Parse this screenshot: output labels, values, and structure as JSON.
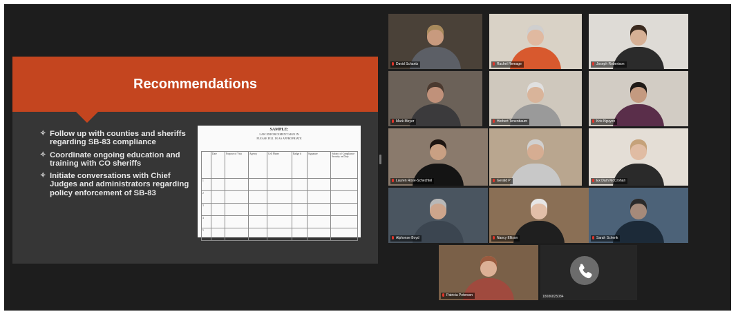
{
  "slide": {
    "title": "Recommendations",
    "bullets": [
      "Follow up with counties and sheriffs regarding SB-83 compliance",
      "Coordinate ongoing education and training with CO sheriffs",
      "Initiate conversations with Chief Judges and administrators regarding policy enforcement of SB-83"
    ],
    "bullet_glyph": "✧",
    "sample_doc": {
      "title": "SAMPLE:",
      "subtitle_1": "LAW ENFORCEMENT SIGN IN",
      "subtitle_2": "PLEASE FILL IN AS APPROPRIATE",
      "columns": [
        "",
        "Date",
        "Purpose of Visit",
        "Agency",
        "Cell Phone",
        "Badge #",
        "Signature",
        "Subject of Compliance Security on Duty"
      ],
      "row_numbers": [
        "1",
        "2",
        "3",
        "4",
        "5"
      ]
    }
  },
  "participants": [
    {
      "name": "David Schantz",
      "bg": "#4a4138",
      "shirt": "#5c5f66",
      "skin": "#c89a7e",
      "hair": "#a88a5c"
    },
    {
      "name": "Rachel Remage",
      "bg": "#d9d2c6",
      "shirt": "#d8592e",
      "skin": "#e0b9a0",
      "hair": "#cfcfcf"
    },
    {
      "name": "Joseph Robertson",
      "bg": "#dedbd6",
      "shirt": "#2b2b2b",
      "skin": "#d6b095",
      "hair": "#3a2a1f"
    },
    {
      "name": "Mark Meyer",
      "bg": "#6b6158",
      "shirt": "#3b3a3c",
      "skin": "#c0917a",
      "hair": "#4a3a30"
    },
    {
      "name": "Herbert Tenenbaum",
      "bg": "#cfc8bd",
      "shirt": "#9a9a9a",
      "skin": "#d9b49a",
      "hair": "#e0e0e0"
    },
    {
      "name": "Kris Nguyen",
      "bg": "#d2ccc4",
      "shirt": "#5a2e4a",
      "skin": "#c49a80",
      "hair": "#1f1a17"
    },
    {
      "name": "Lauren Rose-Schechtel",
      "bg": "#8a7a6c",
      "shirt": "#141414",
      "skin": "#c9a083",
      "hair": "#1d1511"
    },
    {
      "name": "Gerald P",
      "bg": "#b9a68f",
      "shirt": "#c8c8c8",
      "skin": "#d6ad92",
      "hair": "#d0d0d0"
    },
    {
      "name": "Ex Dam McCrohan",
      "bg": "#e4ded6",
      "shirt": "#2a2a2a",
      "skin": "#e0bca3",
      "hair": "#c5a27a"
    },
    {
      "name": "Alphonse Boyd",
      "bg": "#4a5560",
      "shirt": "#3b4550",
      "skin": "#cda58c",
      "hair": "#b8b8b8"
    },
    {
      "name": "Nancy Ellison",
      "bg": "#8a6f55",
      "shirt": "#1f1f1f",
      "skin": "#e2bfa8",
      "hair": "#e6e6e6"
    },
    {
      "name": "Sarah Schenk",
      "bg": "#4c6278",
      "shirt": "#1c2a38",
      "skin": "#a58a7a",
      "hair": "#2a2a2a"
    },
    {
      "name": "Patricia Peterson",
      "bg": "#7a6048",
      "shirt": "#a04a3e",
      "skin": "#dcb096",
      "hair": "#9a5a3e"
    }
  ],
  "phone_participant": {
    "name": "18086825084",
    "icon": "phone-icon"
  },
  "colors": {
    "accent": "#c4451f",
    "active_speaker": "#b3e05a",
    "background": "#1d1d1d"
  }
}
